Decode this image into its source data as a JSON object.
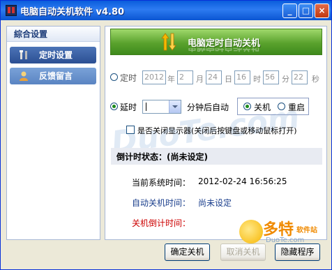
{
  "window": {
    "title": "电脑自动关机软件  v4.80"
  },
  "titlebar": {
    "minimize": "_",
    "maximize": "□",
    "close": "×"
  },
  "sidebar": {
    "header": "綜合设置",
    "items": [
      {
        "label": "定时设置",
        "icon": "tools-icon",
        "selected": true
      },
      {
        "label": "反馈留言",
        "icon": "person-icon",
        "selected": false
      }
    ]
  },
  "banner": {
    "title": "电脑定时自动关机"
  },
  "schedule": {
    "label": "定时",
    "year": "2012",
    "year_unit": "年",
    "month": "2",
    "month_unit": "月",
    "day": "24",
    "day_unit": "日",
    "hour": "16",
    "hour_unit": "时",
    "minute": "56",
    "minute_unit": "分",
    "second": "22",
    "second_unit": "秒"
  },
  "delay": {
    "label": "延时",
    "minutes_value": "",
    "suffix": "分钟后自动",
    "mode_shutdown": "关机",
    "mode_restart": "重启"
  },
  "monitor": {
    "label": "是否关闭显示器(关闭后按键盘或移动鼠标打开)",
    "checked": false
  },
  "countdown": {
    "title": "倒计时状态：(尚未设定)"
  },
  "info": {
    "current_time_label": "当前系统时间：",
    "current_time_value": "2012-02-24 16:56:25",
    "auto_shutdown_label": "自动关机时间：",
    "auto_shutdown_value": "尚未设定",
    "countdown_label": "关机倒计时间："
  },
  "buttons": {
    "confirm": "确定关机",
    "cancel": "取消关机",
    "hide": "隐藏程序"
  },
  "watermark": {
    "text": "DuoTe.com"
  },
  "logo": {
    "big": "多特",
    "small": "软件站",
    "sub": "DuoTe.com"
  },
  "colors": {
    "titlebar": "#0a5ddc",
    "banner": "#5aa22d",
    "countdown_red": "#cc0000",
    "info_blue": "#1a3e8c"
  }
}
